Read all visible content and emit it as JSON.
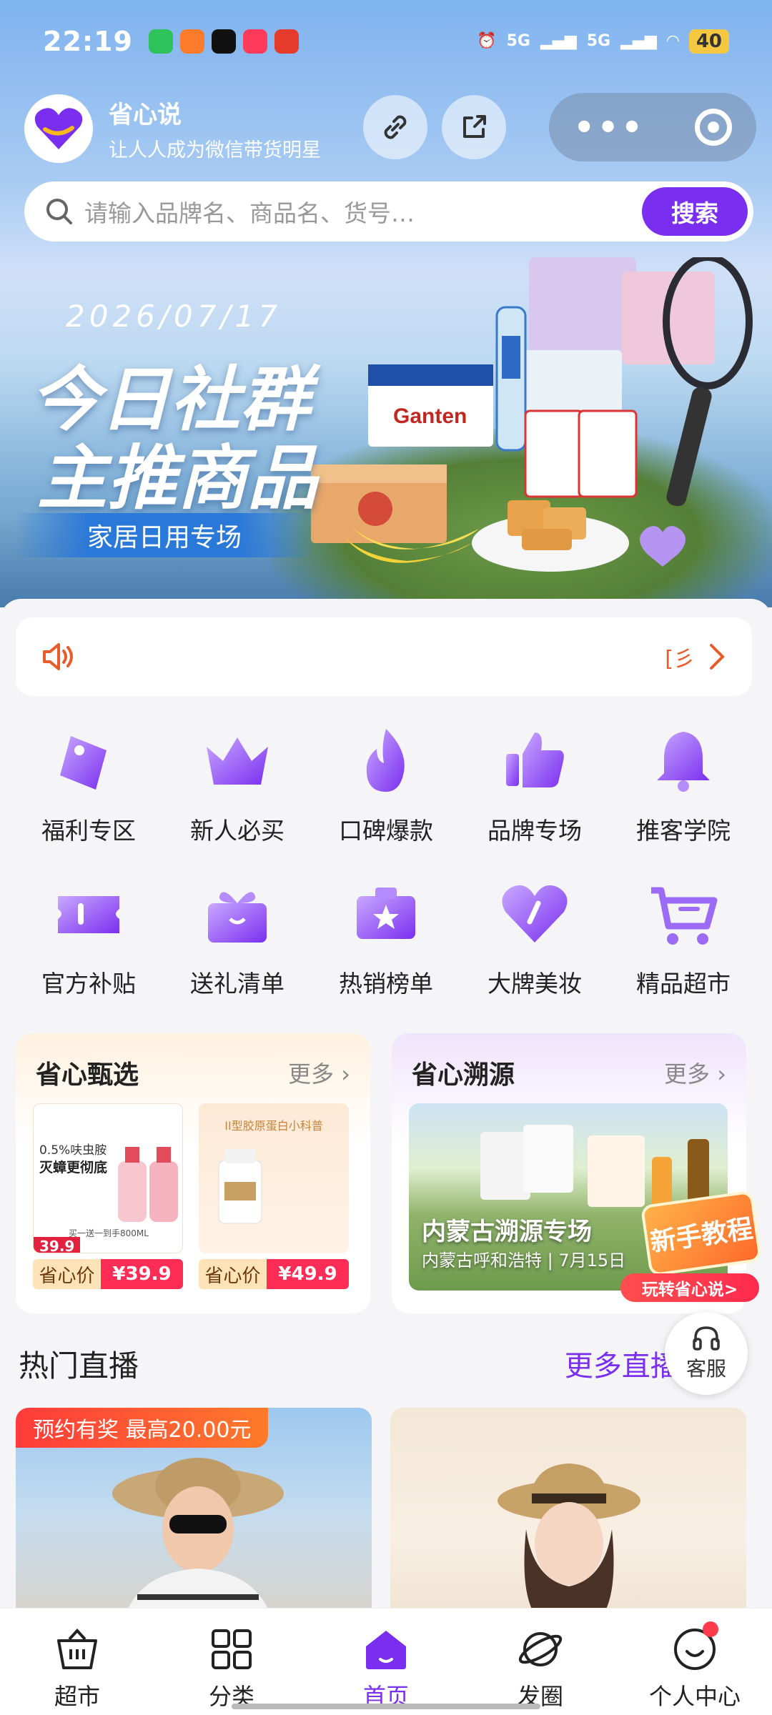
{
  "status": {
    "time": "22:19",
    "network1": "5G",
    "network2": "5G",
    "battery": "40"
  },
  "app": {
    "name": "省心说",
    "slogan": "让人人成为微信带货明星"
  },
  "search": {
    "placeholder": "请输入品牌名、商品名、货号…",
    "button": "搜索"
  },
  "banner": {
    "date": "2026/07/17",
    "title_line1": "今日社群",
    "title_line2": "主推商品",
    "tag": "家居日用专场"
  },
  "notice": {
    "end_text": "[彡"
  },
  "categories": [
    {
      "label": "福利专区",
      "icon": "tag-icon"
    },
    {
      "label": "新人必买",
      "icon": "crown-icon"
    },
    {
      "label": "口碑爆款",
      "icon": "flame-icon"
    },
    {
      "label": "品牌专场",
      "icon": "thumbs-up-icon"
    },
    {
      "label": "推客学院",
      "icon": "bell-icon"
    },
    {
      "label": "官方补贴",
      "icon": "ticket-icon"
    },
    {
      "label": "送礼清单",
      "icon": "gift-icon"
    },
    {
      "label": "热销榜单",
      "icon": "star-folder-icon"
    },
    {
      "label": "大牌美妆",
      "icon": "heart-icon"
    },
    {
      "label": "精品超市",
      "icon": "cart-icon"
    }
  ],
  "selection": {
    "title": "省心甄选",
    "more": "更多",
    "items": [
      {
        "price_label": "省心价",
        "price": "¥39.9",
        "img_price": "39.9",
        "img_text1": "0.5%呋虫胺",
        "img_text2": "灭蟑更彻底",
        "img_text3": "买一送一到手800ML"
      },
      {
        "price_label": "省心价",
        "price": "¥49.9",
        "img_text1": "II型胶原蛋白小科普"
      }
    ]
  },
  "traceability": {
    "title": "省心溯源",
    "more": "更多",
    "img_title": "内蒙古溯源专场",
    "img_sub": "内蒙古呼和浩特 | 7月15日",
    "tutorial_badge": "新手教程",
    "tutorial_play": "玩转省心说>"
  },
  "live": {
    "title": "热门直播",
    "more": "更多直播 >",
    "promo": "预约有奖 最高20.00元"
  },
  "service": {
    "label": "客服"
  },
  "tabs": [
    {
      "label": "超市",
      "icon": "basket-icon"
    },
    {
      "label": "分类",
      "icon": "grid-icon"
    },
    {
      "label": "首页",
      "icon": "home-icon"
    },
    {
      "label": "发圈",
      "icon": "planet-icon"
    },
    {
      "label": "个人中心",
      "icon": "smile-icon"
    }
  ],
  "colors": {
    "brand": "#7a2ff0",
    "accent_red": "#ff2d55",
    "notice_orange": "#e85c2a"
  }
}
